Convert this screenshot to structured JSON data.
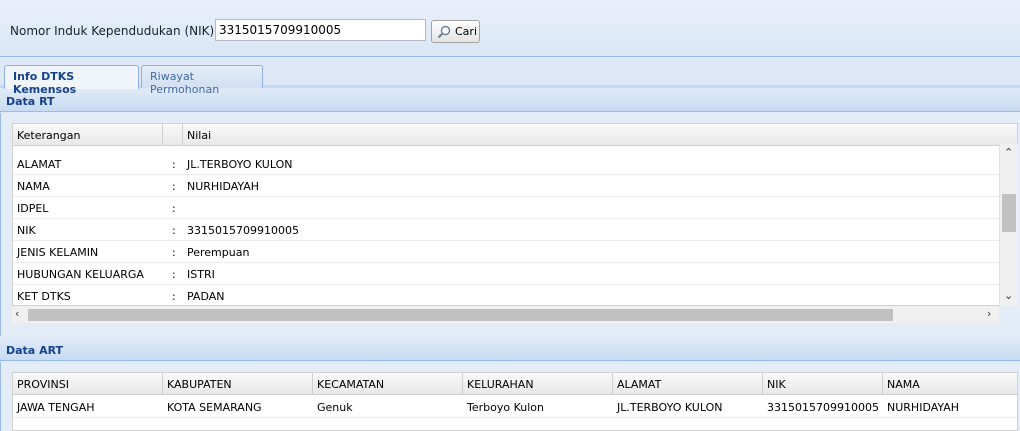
{
  "search": {
    "label": "Nomor Induk Kependudukan (NIK):",
    "value": "3315015709910005",
    "button_label": "Cari"
  },
  "tabs": [
    {
      "label": "Info DTKS Kemensos",
      "active": true
    },
    {
      "label": "Riwayat Permohonan",
      "active": false
    }
  ],
  "data_rt": {
    "title": "Data RT",
    "columns": [
      "Keterangan",
      "Nilai"
    ],
    "separator": ":",
    "rows": [
      {
        "key": "ALAMAT",
        "value": "JL.TERBOYO KULON"
      },
      {
        "key": "NAMA",
        "value": "NURHIDAYAH"
      },
      {
        "key": "IDPEL",
        "value": ""
      },
      {
        "key": "NIK",
        "value": "3315015709910005"
      },
      {
        "key": "JENIS KELAMIN",
        "value": "Perempuan"
      },
      {
        "key": "HUBUNGAN KELUARGA",
        "value": "ISTRI"
      },
      {
        "key": "KET DTKS",
        "value": "PADAN"
      }
    ]
  },
  "data_art": {
    "title": "Data ART",
    "columns": [
      "PROVINSI",
      "KABUPATEN",
      "KECAMATAN",
      "KELURAHAN",
      "ALAMAT",
      "NIK",
      "NAMA"
    ],
    "rows": [
      [
        "JAWA TENGAH",
        "KOTA SEMARANG",
        "Genuk",
        "Terboyo Kulon",
        "JL.TERBOYO KULON",
        "3315015709910005",
        "NURHIDAYAH"
      ]
    ]
  },
  "icons": {
    "search": "search-icon",
    "scroll_up": "chevron-up-icon",
    "scroll_down": "chevron-down-icon",
    "scroll_left": "chevron-left-icon",
    "scroll_right": "chevron-right-icon"
  },
  "colors": {
    "panel_title": "#15428b",
    "border": "#99bbe8",
    "background": "#dfe8f6"
  }
}
